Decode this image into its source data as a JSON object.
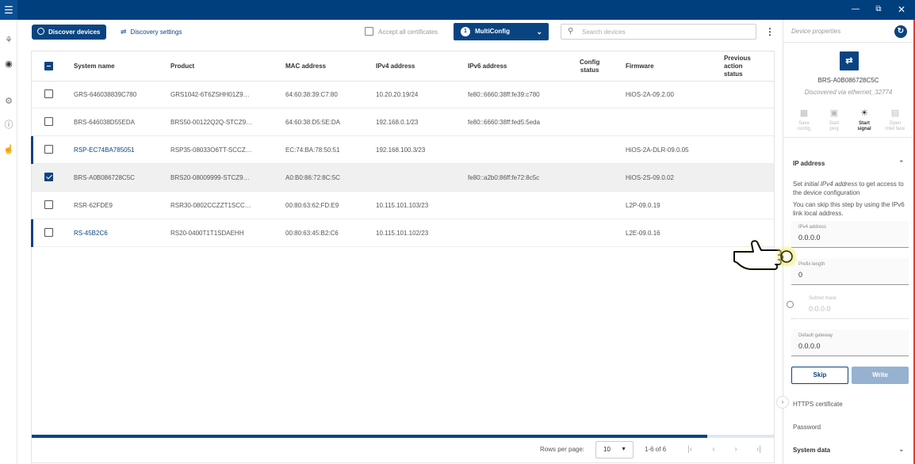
{
  "toolbar": {
    "discover_label": "Discover devices",
    "settings_label": "Discovery settings",
    "accept_certs_label": "Accept all certificates",
    "multiconfig_count": "1",
    "multiconfig_label": "MultiConfig",
    "search_placeholder": "Search devices"
  },
  "table": {
    "headers": {
      "system_name": "System name",
      "product": "Product",
      "mac": "MAC address",
      "ipv4": "IPv4 address",
      "ipv6": "IPv6 address",
      "config_status_1": "Config",
      "config_status_2": "status",
      "firmware": "Firmware",
      "prev_1": "Previous",
      "prev_2": "action",
      "prev_3": "status"
    },
    "rows": [
      {
        "name": "GRS-646038839C780",
        "product": "GRS1042-6T6ZSHH01Z9…",
        "mac": "64:60:38:39:C7:80",
        "ipv4": "10.20.20.19/24",
        "ipv6": "fe80::6660:38ff:fe39:c780",
        "firmware": "HiOS-2A-09.2.00"
      },
      {
        "name": "BRS-646038D55EDA",
        "product": "BRS50-00122Q2Q-STCZ9…",
        "mac": "64:60:38:D5:5E:DA",
        "ipv4": "192.168.0.1/23",
        "ipv6": "fe80::6660:38ff:fed5:5eda",
        "firmware": ""
      },
      {
        "name": "RSP-EC74BA785051",
        "product": "RSP35-08033O6TT-SCCZ…",
        "mac": "EC:74:BA:78:50:51",
        "ipv4": "192.168.100.3/23",
        "ipv6": "",
        "firmware": "HiOS-2A-DLR-09.0.05"
      },
      {
        "name": "BRS-A0B086728C5C",
        "product": "BRS20-08009999-STCZ9…",
        "mac": "A0:B0:86:72:8C:5C",
        "ipv4": "",
        "ipv6": "fe80::a2b0:86ff:fe72:8c5c",
        "firmware": "HiOS-2S-09.0.02"
      },
      {
        "name": "RSR-62FDE9",
        "product": "RSR30-0802CCZZT1SCC…",
        "mac": "00:80:63:62:FD:E9",
        "ipv4": "10.115.101.103/23",
        "ipv6": "",
        "firmware": "L2P-09.0.19"
      },
      {
        "name": "RS-45B2C6",
        "product": "RS20-0400T1T1SDAEHH",
        "mac": "00:80:63:45:B2:C6",
        "ipv4": "10.115.101.102/23",
        "ipv6": "",
        "firmware": "L2E-09.0.16"
      }
    ],
    "scroll_fraction": 0.91
  },
  "pager": {
    "rows_per_page_label": "Rows per page:",
    "rows_per_page_value": "10",
    "range": "1-6 of 6"
  },
  "panel": {
    "title": "Device properties",
    "device_name": "BRS-A0B086728C5C",
    "discovered_via": "Discovered via ethernet_32774",
    "actions": [
      {
        "line1": "Save",
        "line2": "config"
      },
      {
        "line1": "Start",
        "line2": "ping"
      },
      {
        "line1": "Start",
        "line2": "signal"
      },
      {
        "line1": "Open",
        "line2": "Intel face"
      }
    ],
    "ip_section": {
      "title": "IP address",
      "help_1_pre": "Set ",
      "help_1_italic": "initial IPv4 address",
      "help_1_post": " to get access to the device configuration",
      "help_2": "You can skip this step by using the IPv6 link local address.",
      "fields": [
        {
          "label": "IPv4 address",
          "value": "0.0.0.0"
        },
        {
          "label": "Prefix length",
          "value": "0"
        },
        {
          "label": "Subnet mask",
          "value": "0.0.0.0"
        },
        {
          "label": "Default gateway",
          "value": "0.0.0.0"
        }
      ],
      "skip_label": "Skip",
      "write_label": "Write"
    },
    "https_label": "HTTPS certificate",
    "password_label": "Password",
    "system_data_label": "System data"
  },
  "colors": {
    "brand": "#003f7d",
    "accent": "#0a4480",
    "write_disabled": "#97b1d0",
    "highlight": "#f0ea6a"
  }
}
